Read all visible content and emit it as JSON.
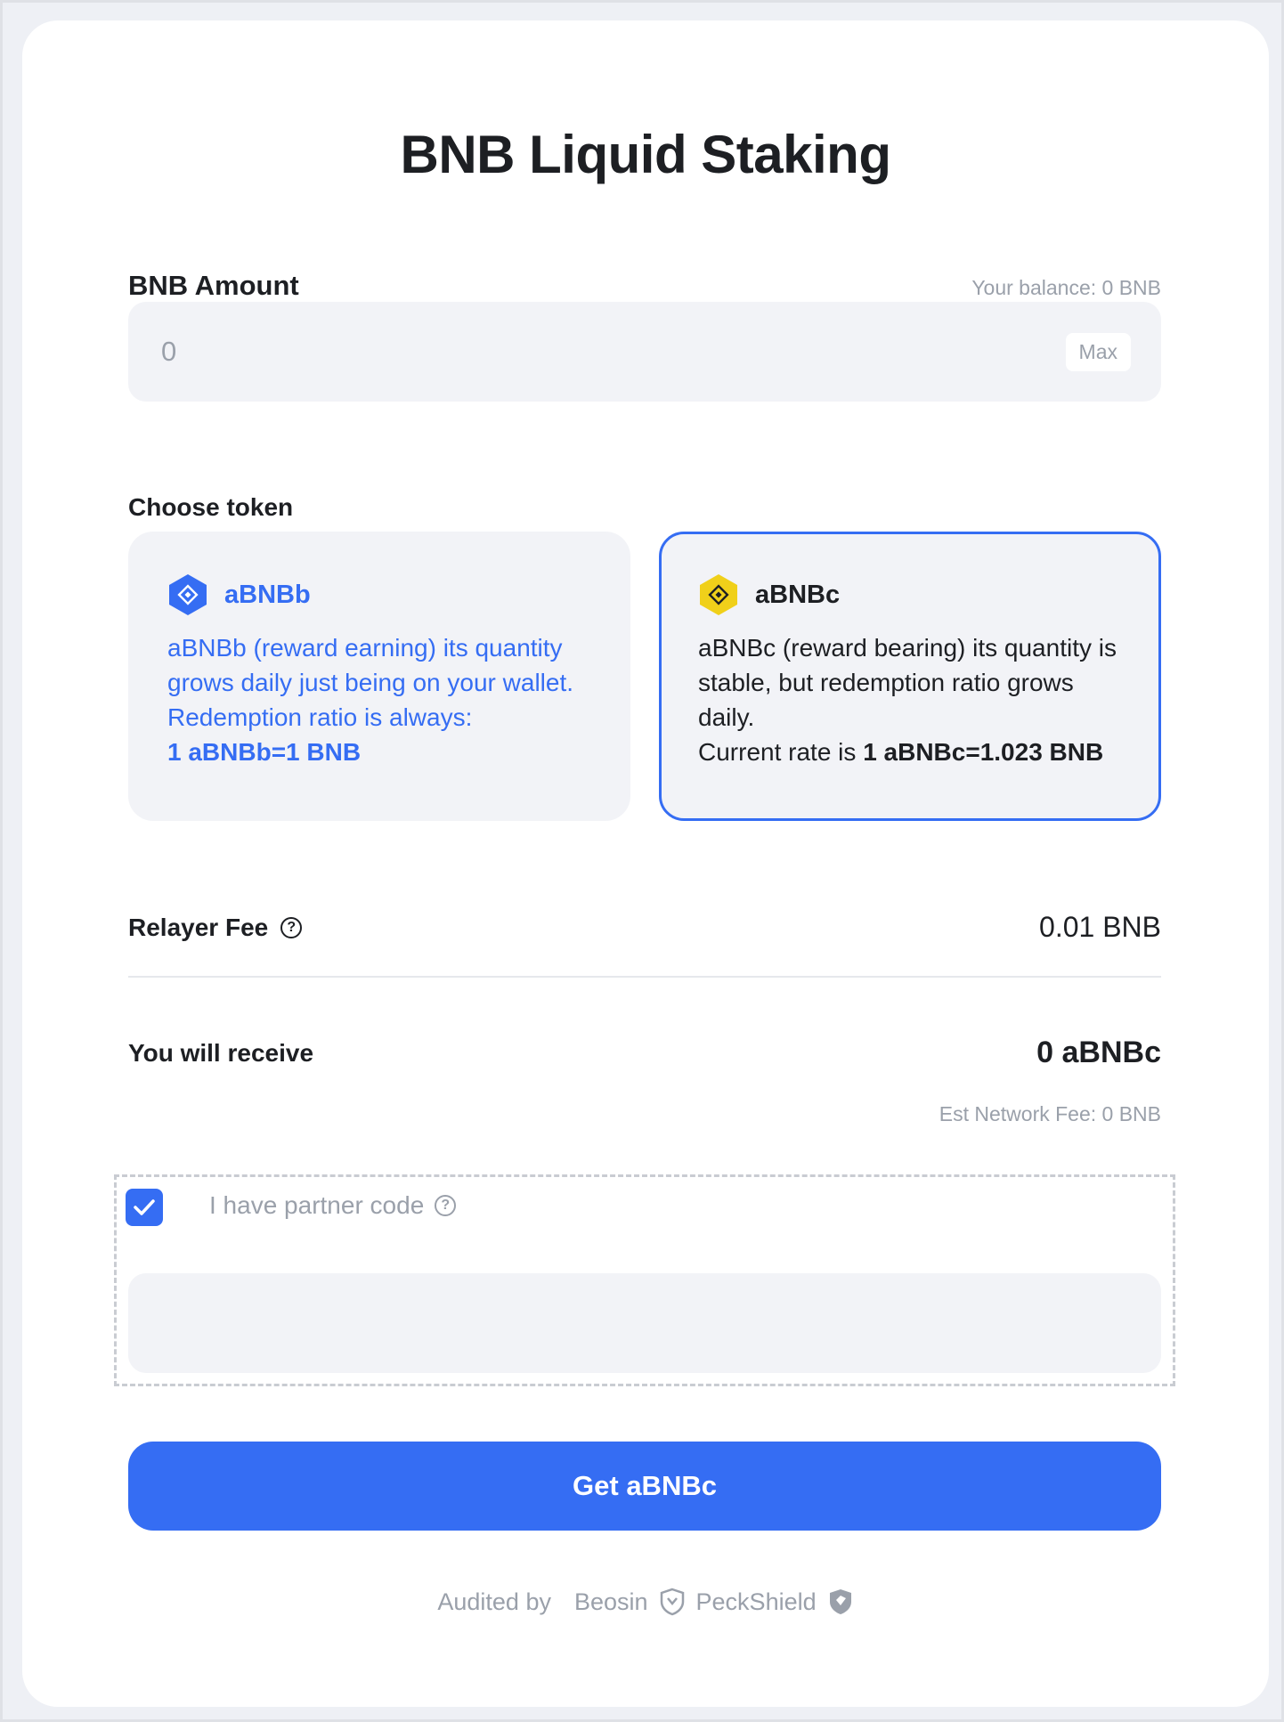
{
  "title": "BNB Liquid Staking",
  "amount": {
    "label": "BNB Amount",
    "balance": "Your balance: 0 BNB",
    "value": "0",
    "max_label": "Max"
  },
  "choose_token": {
    "label": "Choose token",
    "options": [
      {
        "name": "aBNBb",
        "desc": "aBNBb (reward earning) its quantity grows daily just being on your wallet. Redemption ratio is always:",
        "rate": "1 aBNBb=1 BNB",
        "icon": "abnbb-hex-icon",
        "color": "#356df3",
        "selected": false
      },
      {
        "name": "aBNBc",
        "desc": "aBNBc (reward bearing) its quantity is stable, but redemption ratio grows daily.",
        "rate_prefix": "Current rate is",
        "rate": "1 aBNBc=1.023 BNB",
        "icon": "abnbc-hex-icon",
        "color": "#f0d01a",
        "selected": true
      }
    ]
  },
  "relayer_fee": {
    "label": "Relayer Fee",
    "value": "0.01 BNB"
  },
  "receive": {
    "label": "You will receive",
    "value": "0 aBNBc"
  },
  "network_fee": "Est Network Fee: 0 BNB",
  "partner": {
    "checked": true,
    "label": "I have partner code",
    "value": ""
  },
  "cta_label": "Get aBNBc",
  "footer": {
    "audited_by": "Audited by",
    "auditors": [
      "Beosin",
      "PeckShield"
    ]
  },
  "colors": {
    "accent": "#356df3",
    "muted": "#9aa0aa",
    "field": "#f2f3f7"
  }
}
